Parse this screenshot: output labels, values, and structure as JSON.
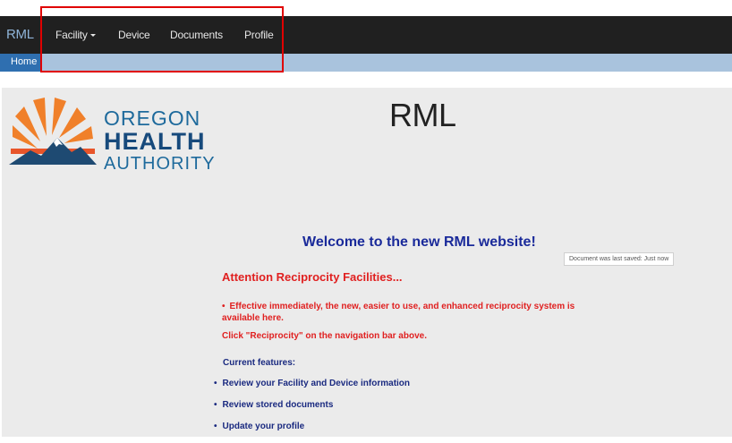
{
  "navbar": {
    "brand": "RML",
    "items": [
      {
        "label": "Facility",
        "has_dropdown": true
      },
      {
        "label": "Device"
      },
      {
        "label": "Documents"
      },
      {
        "label": "Profile"
      }
    ]
  },
  "breadcrumb": {
    "home": "Home"
  },
  "logo": {
    "line1": "OREGON",
    "line2": "HEALTH",
    "line3": "AUTHORITY"
  },
  "page": {
    "title": "RML",
    "welcome": "Welcome to the new RML website!",
    "saved_status": "Document was last saved: Just now",
    "attention": "Attention Reciprocity Facilities...",
    "notice_bullet": "•",
    "notice": "Effective immediately, the new, easier to use, and enhanced reciprocity system is available here.",
    "click_line": "Click \"Reciprocity\" on the navigation bar above.",
    "features_heading": "Current features:",
    "features": [
      "Review your Facility and Device information",
      "Review stored documents",
      "Update your profile"
    ],
    "feature_bullet": "•"
  },
  "colors": {
    "navbar_bg": "#202020",
    "breadcrumb_bg": "#a9c3dd",
    "home_bg": "#2f6fb0",
    "highlight": "#e00000",
    "heading_blue": "#1a2a9a",
    "alert_red": "#e02020",
    "logo_orange": "#f0802a",
    "logo_blue": "#1e6a9c"
  }
}
